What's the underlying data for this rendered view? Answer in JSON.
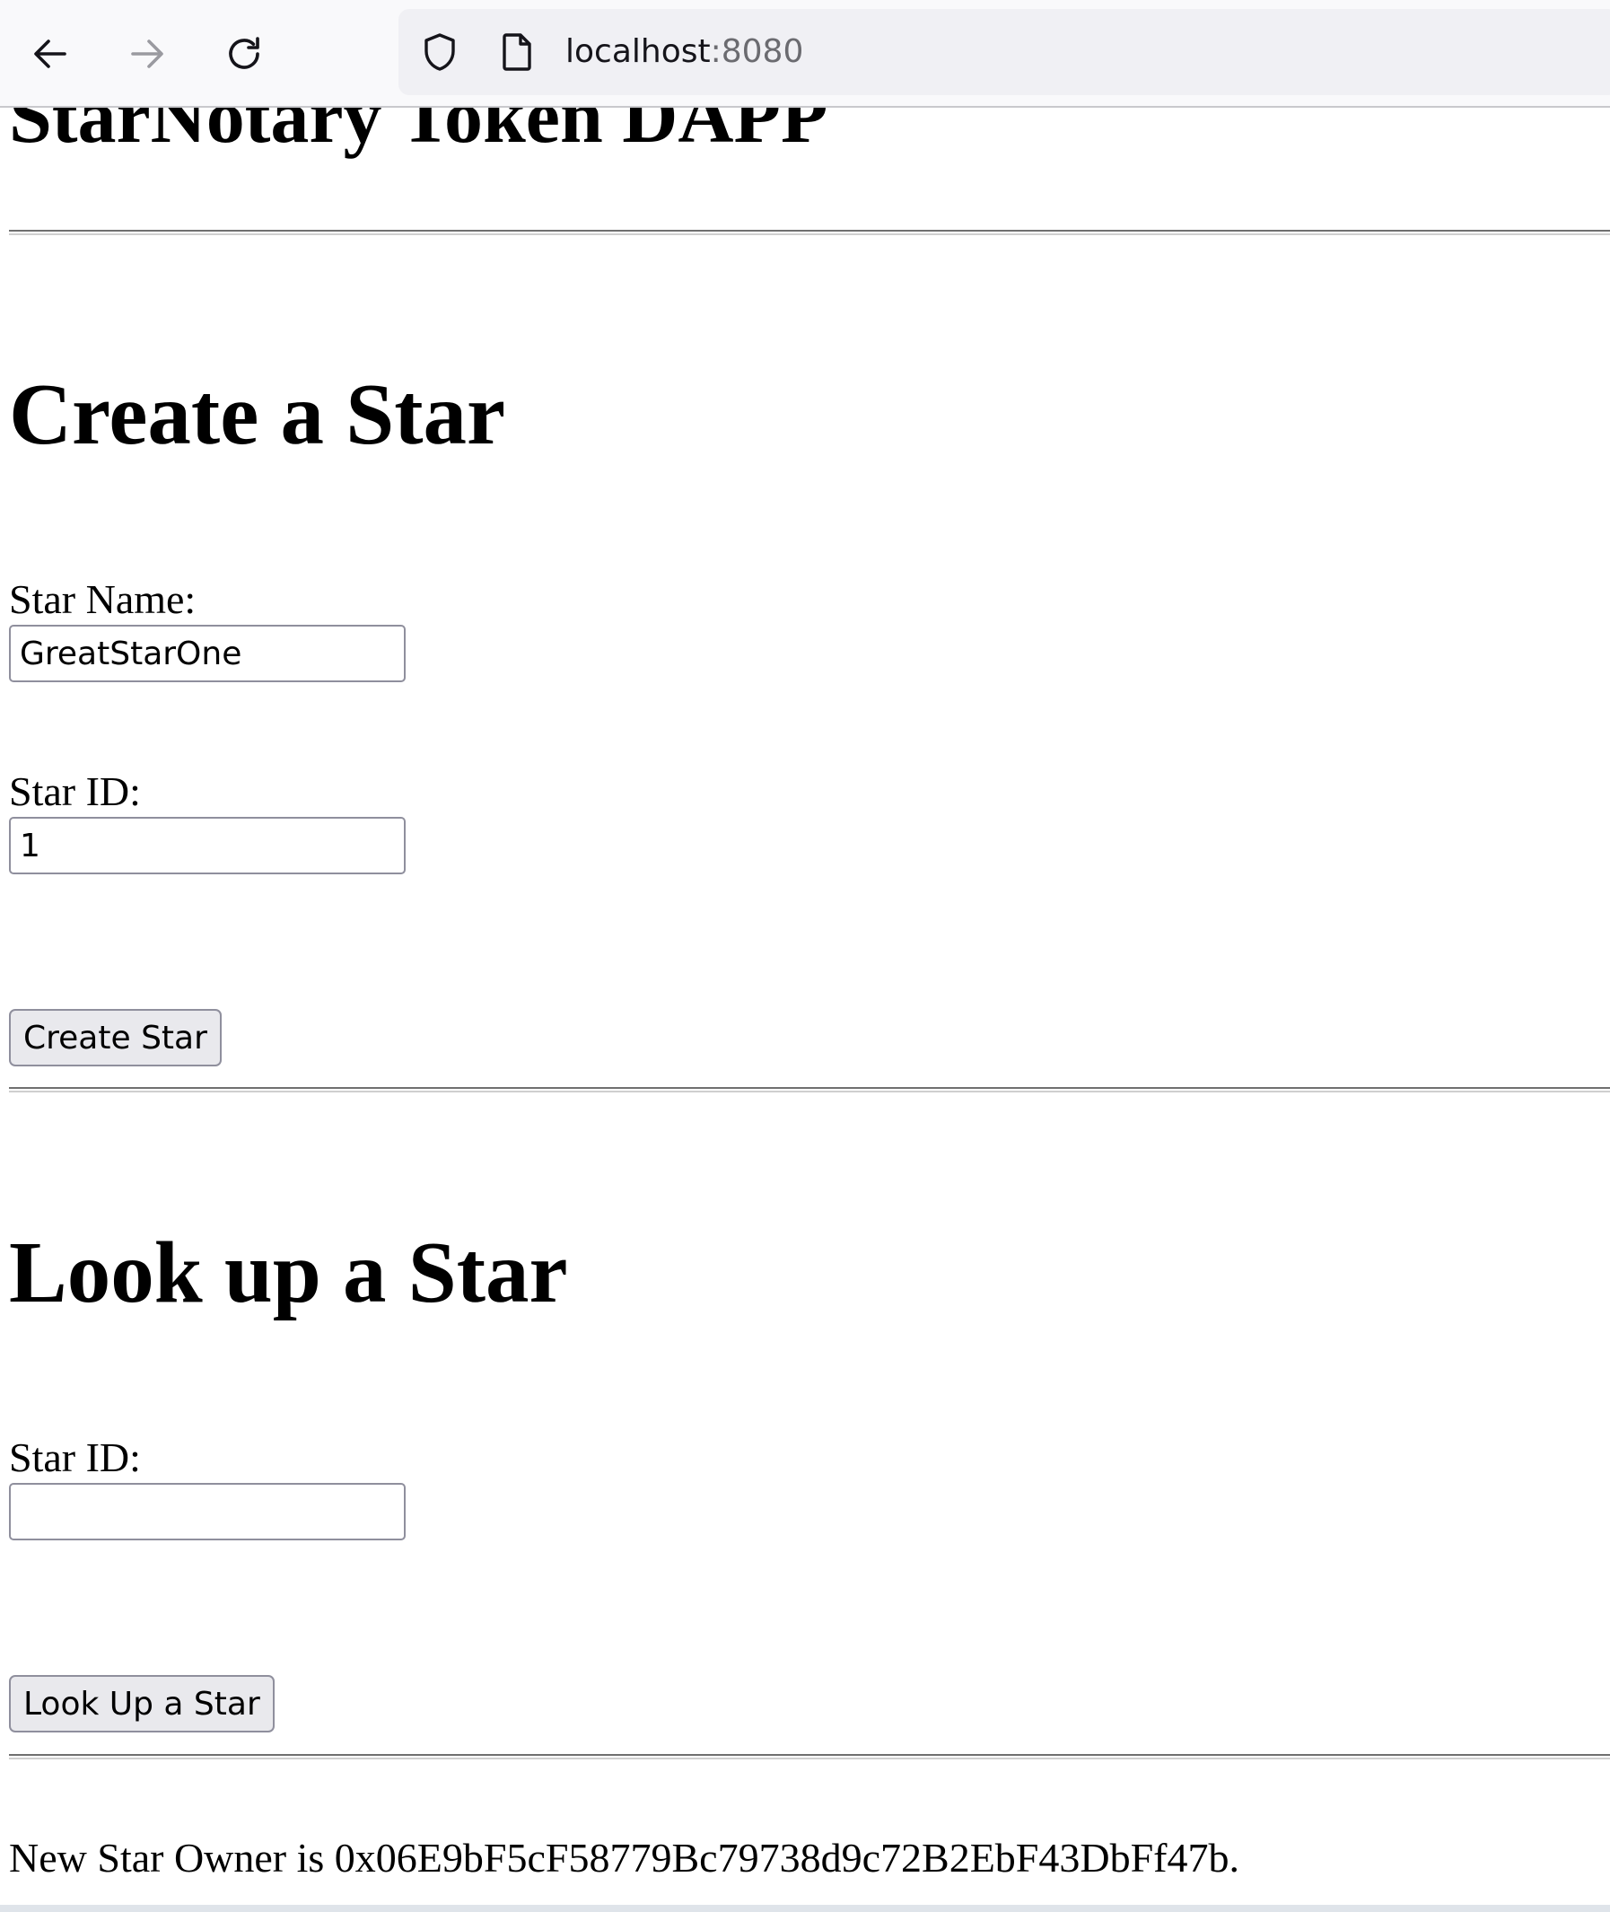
{
  "browser": {
    "url_host": "localhost",
    "url_port": ":8080",
    "back_icon": "arrow-left-icon",
    "forward_icon": "arrow-right-icon",
    "reload_icon": "reload-icon",
    "shield_icon": "shield-icon",
    "page_icon": "page-icon"
  },
  "page": {
    "title": "StarNotary Token DAPP",
    "create": {
      "heading": "Create a Star",
      "name_label": "Star Name:",
      "name_value": "GreatStarOne",
      "id_label": "Star ID:",
      "id_value": "1",
      "button_label": "Create Star"
    },
    "lookup": {
      "heading": "Look up a Star",
      "id_label": "Star ID:",
      "id_value": "",
      "button_label": "Look Up a Star"
    },
    "status": "New Star Owner is 0x06E9bF5cF58779Bc79738d9c72B2EbF43DbFf47b."
  },
  "colors": {
    "toolbar_bg": "#f9f9fb",
    "urlbar_bg": "#f0f0f4",
    "button_bg": "#e9e9ed",
    "input_border": "#8f8f9d"
  }
}
